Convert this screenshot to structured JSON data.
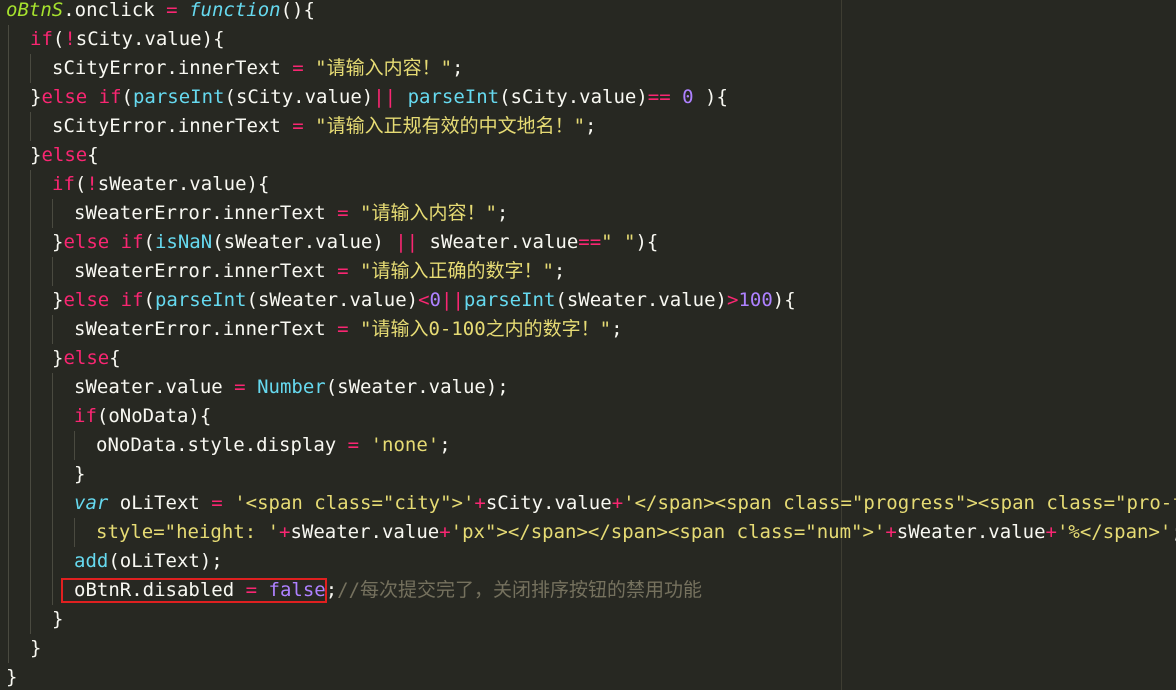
{
  "editor": {
    "theme_colors": {
      "background": "#272822",
      "keyword": "#f92672",
      "string": "#e6db74",
      "number": "#ae81ff",
      "function": "#66d9ef",
      "variable": "#a6e22e",
      "comment": "#75715e",
      "highlight_box": "#e02020"
    },
    "lines": [
      {
        "tokens": [
          {
            "t": "oBtnS",
            "c": "var"
          },
          {
            "t": ".onclick ",
            "c": "p"
          },
          {
            "t": "=",
            "c": "op"
          },
          {
            "t": " ",
            "c": "p"
          },
          {
            "t": "function",
            "c": "fn"
          },
          {
            "t": "(){",
            "c": "p"
          }
        ]
      },
      {
        "tokens": [
          {
            "t": "if",
            "c": "kw"
          },
          {
            "t": "(",
            "c": "p"
          },
          {
            "t": "!",
            "c": "op"
          },
          {
            "t": "sCity.value){",
            "c": "p"
          }
        ]
      },
      {
        "tokens": [
          {
            "t": "sCityError.innerText ",
            "c": "p"
          },
          {
            "t": "=",
            "c": "op"
          },
          {
            "t": " ",
            "c": "p"
          },
          {
            "t": "\"请输入内容！\"",
            "c": "str"
          },
          {
            "t": ";",
            "c": "p"
          }
        ]
      },
      {
        "tokens": [
          {
            "t": "}",
            "c": "p"
          },
          {
            "t": "else if",
            "c": "kw"
          },
          {
            "t": "(",
            "c": "p"
          },
          {
            "t": "parseInt",
            "c": "bi"
          },
          {
            "t": "(sCity.value)",
            "c": "p"
          },
          {
            "t": "||",
            "c": "op"
          },
          {
            "t": " ",
            "c": "p"
          },
          {
            "t": "parseInt",
            "c": "bi"
          },
          {
            "t": "(sCity.value)",
            "c": "p"
          },
          {
            "t": "==",
            "c": "op"
          },
          {
            "t": " ",
            "c": "p"
          },
          {
            "t": "0",
            "c": "num"
          },
          {
            "t": " ){",
            "c": "p"
          }
        ]
      },
      {
        "tokens": [
          {
            "t": "sCityError.innerText ",
            "c": "p"
          },
          {
            "t": "=",
            "c": "op"
          },
          {
            "t": " ",
            "c": "p"
          },
          {
            "t": "\"请输入正规有效的中文地名！\"",
            "c": "str"
          },
          {
            "t": ";",
            "c": "p"
          }
        ]
      },
      {
        "tokens": [
          {
            "t": "}",
            "c": "p"
          },
          {
            "t": "else",
            "c": "kw"
          },
          {
            "t": "{",
            "c": "p"
          }
        ]
      },
      {
        "tokens": [
          {
            "t": "if",
            "c": "kw"
          },
          {
            "t": "(",
            "c": "p"
          },
          {
            "t": "!",
            "c": "op"
          },
          {
            "t": "sWeater.value){",
            "c": "p"
          }
        ]
      },
      {
        "tokens": [
          {
            "t": "sWeaterError.innerText ",
            "c": "p"
          },
          {
            "t": "=",
            "c": "op"
          },
          {
            "t": " ",
            "c": "p"
          },
          {
            "t": "\"请输入内容！\"",
            "c": "str"
          },
          {
            "t": ";",
            "c": "p"
          }
        ]
      },
      {
        "tokens": [
          {
            "t": "}",
            "c": "p"
          },
          {
            "t": "else if",
            "c": "kw"
          },
          {
            "t": "(",
            "c": "p"
          },
          {
            "t": "isNaN",
            "c": "bi"
          },
          {
            "t": "(sWeater.value) ",
            "c": "p"
          },
          {
            "t": "||",
            "c": "op"
          },
          {
            "t": " sWeater.value",
            "c": "p"
          },
          {
            "t": "==",
            "c": "op"
          },
          {
            "t": "\" \"",
            "c": "str"
          },
          {
            "t": "){",
            "c": "p"
          }
        ]
      },
      {
        "tokens": [
          {
            "t": "sWeaterError.innerText ",
            "c": "p"
          },
          {
            "t": "=",
            "c": "op"
          },
          {
            "t": " ",
            "c": "p"
          },
          {
            "t": "\"请输入正确的数字！\"",
            "c": "str"
          },
          {
            "t": ";",
            "c": "p"
          }
        ]
      },
      {
        "tokens": [
          {
            "t": "}",
            "c": "p"
          },
          {
            "t": "else if",
            "c": "kw"
          },
          {
            "t": "(",
            "c": "p"
          },
          {
            "t": "parseInt",
            "c": "bi"
          },
          {
            "t": "(sWeater.value)",
            "c": "p"
          },
          {
            "t": "<",
            "c": "op"
          },
          {
            "t": "0",
            "c": "num"
          },
          {
            "t": "||",
            "c": "op"
          },
          {
            "t": "parseInt",
            "c": "bi"
          },
          {
            "t": "(sWeater.value)",
            "c": "p"
          },
          {
            "t": ">",
            "c": "op"
          },
          {
            "t": "100",
            "c": "num"
          },
          {
            "t": "){",
            "c": "p"
          }
        ]
      },
      {
        "tokens": [
          {
            "t": "sWeaterError.innerText ",
            "c": "p"
          },
          {
            "t": "=",
            "c": "op"
          },
          {
            "t": " ",
            "c": "p"
          },
          {
            "t": "\"请输入0-100之内的数字！\"",
            "c": "str"
          },
          {
            "t": ";",
            "c": "p"
          }
        ]
      },
      {
        "tokens": [
          {
            "t": "}",
            "c": "p"
          },
          {
            "t": "else",
            "c": "kw"
          },
          {
            "t": "{",
            "c": "p"
          }
        ]
      },
      {
        "tokens": [
          {
            "t": "sWeater.value ",
            "c": "p"
          },
          {
            "t": "=",
            "c": "op"
          },
          {
            "t": " ",
            "c": "p"
          },
          {
            "t": "Number",
            "c": "bi"
          },
          {
            "t": "(sWeater.value);",
            "c": "p"
          }
        ]
      },
      {
        "tokens": [
          {
            "t": "if",
            "c": "kw"
          },
          {
            "t": "(oNoData){",
            "c": "p"
          }
        ]
      },
      {
        "tokens": [
          {
            "t": "oNoData.style.display ",
            "c": "p"
          },
          {
            "t": "=",
            "c": "op"
          },
          {
            "t": " ",
            "c": "p"
          },
          {
            "t": "'none'",
            "c": "str"
          },
          {
            "t": ";",
            "c": "p"
          }
        ]
      },
      {
        "tokens": [
          {
            "t": "}",
            "c": "p"
          }
        ]
      },
      {
        "tokens": [
          {
            "t": "var",
            "c": "dstyle"
          },
          {
            "t": " oLiText ",
            "c": "p"
          },
          {
            "t": "=",
            "c": "op"
          },
          {
            "t": " ",
            "c": "p"
          },
          {
            "t": "'<span class=\"city\">'",
            "c": "str"
          },
          {
            "t": "+",
            "c": "op"
          },
          {
            "t": "sCity.value",
            "c": "p"
          },
          {
            "t": "+",
            "c": "op"
          },
          {
            "t": "'</span><span class=\"progress\"><span class=\"pro-flo\"",
            "c": "str"
          }
        ]
      },
      {
        "tokens": [
          {
            "t": "style=\"height: '",
            "c": "str"
          },
          {
            "t": "+",
            "c": "op"
          },
          {
            "t": "sWeater.value",
            "c": "p"
          },
          {
            "t": "+",
            "c": "op"
          },
          {
            "t": "'px\"></span></span><span class=\"num\">'",
            "c": "str"
          },
          {
            "t": "+",
            "c": "op"
          },
          {
            "t": "sWeater.value",
            "c": "p"
          },
          {
            "t": "+",
            "c": "op"
          },
          {
            "t": "'%</span>'",
            "c": "str"
          },
          {
            "t": ";",
            "c": "p"
          }
        ]
      },
      {
        "tokens": [
          {
            "t": "add",
            "c": "bi"
          },
          {
            "t": "(oLiText);",
            "c": "p"
          }
        ]
      },
      {
        "tokens": [
          {
            "t": "oBtnR.disabled ",
            "c": "p"
          },
          {
            "t": "=",
            "c": "op"
          },
          {
            "t": " ",
            "c": "p"
          },
          {
            "t": "false",
            "c": "bool"
          },
          {
            "t": ";",
            "c": "p"
          },
          {
            "t": "//每次提交完了，关闭排序按钮的禁用功能",
            "c": "cm"
          }
        ]
      },
      {
        "tokens": [
          {
            "t": "}",
            "c": "p"
          }
        ]
      },
      {
        "tokens": [
          {
            "t": "}",
            "c": "p"
          }
        ]
      },
      {
        "tokens": [
          {
            "t": "}",
            "c": "p"
          }
        ]
      }
    ]
  }
}
